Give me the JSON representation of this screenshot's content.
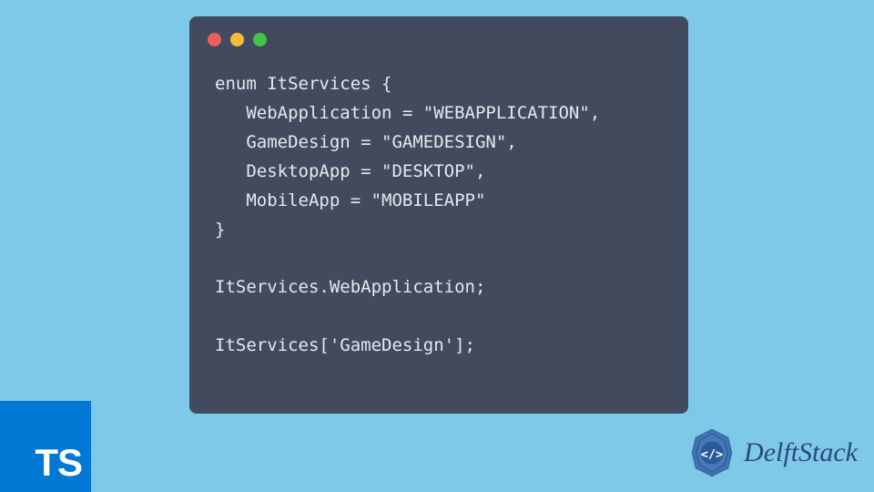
{
  "code": {
    "lines": [
      "enum ItServices {",
      "   WebApplication = \"WEBAPPLICATION\",",
      "   GameDesign = \"GAMEDESIGN\",",
      "   DesktopApp = \"DESKTOP\",",
      "   MobileApp = \"MOBILEAPP\"",
      "}",
      "",
      "ItServices.WebApplication;",
      "",
      "ItServices['GameDesign'];"
    ]
  },
  "ts_badge": {
    "label": "TS"
  },
  "brand": {
    "name": "DelftStack"
  },
  "colors": {
    "background": "#7ec8e8",
    "window_bg": "#424a5e",
    "ts_blue": "#0078d4",
    "delft_blue": "#2a4a7a",
    "code_text": "#e6e8ed"
  }
}
